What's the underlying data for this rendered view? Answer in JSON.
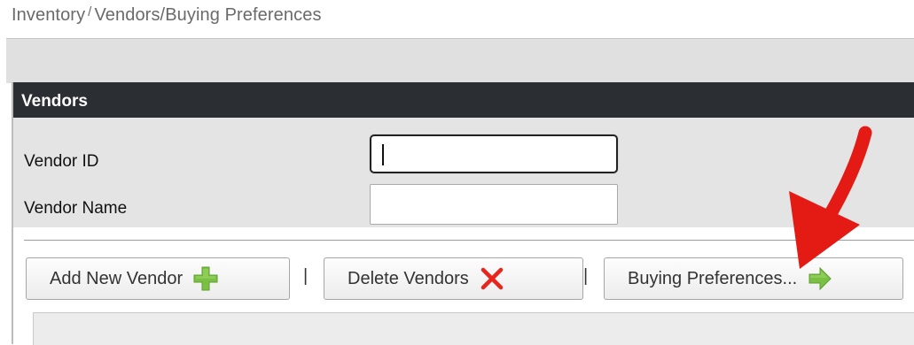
{
  "breadcrumb": {
    "root": "Inventory",
    "separator": "/",
    "path": "Vendors/Buying Preferences"
  },
  "panel": {
    "title": "Vendors"
  },
  "form": {
    "vendor_id_label": "Vendor ID",
    "vendor_id_value": "",
    "vendor_name_label": "Vendor Name",
    "vendor_name_value": ""
  },
  "toolbar": {
    "add_label": "Add New Vendor",
    "add_icon": "plus-icon",
    "delete_label": "Delete Vendors",
    "delete_icon": "x-icon",
    "buying_label": "Buying Preferences...",
    "buying_icon": "arrow-right-icon",
    "separator": "|"
  },
  "colors": {
    "header_bg": "#2b2f33",
    "plus_green": "#7ac143",
    "delete_red": "#e8241c",
    "annotation_red": "#e31b14"
  }
}
